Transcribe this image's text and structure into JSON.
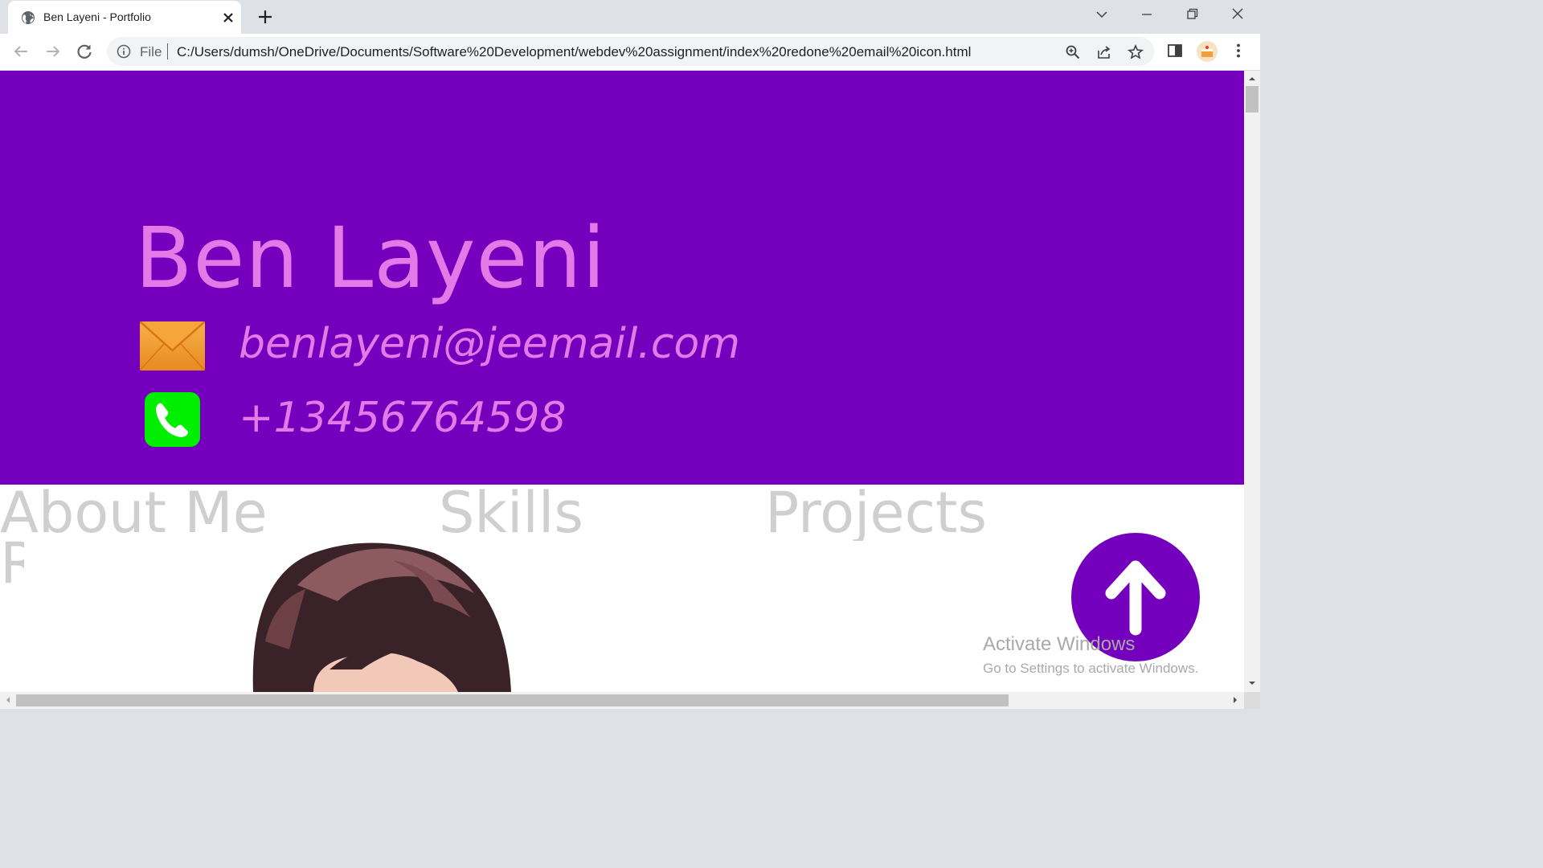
{
  "browser": {
    "tab_title": "Ben Layeni - Portfolio",
    "address_scheme": "File",
    "address_url": "C:/Users/dumsh/OneDrive/Documents/Software%20Development/webdev%20assignment/index%20redone%20email%20icon.html"
  },
  "hero": {
    "name": "Ben Layeni",
    "email": "benlayeni@jeemail.com",
    "phone": "+13456764598"
  },
  "nav": {
    "about": "About Me",
    "skills": "Skills",
    "projects": "Projects",
    "wrapped": "R"
  },
  "watermark": {
    "line1": "Activate Windows",
    "line2": "Go to Settings to activate Windows."
  },
  "colors": {
    "hero_bg": "#7400bd",
    "hero_text": "#e47ae8",
    "nav_text": "#cfcfcf",
    "accent": "#7400bd",
    "phone_icon_bg": "#00ee00",
    "mail_icon": "#f29a2e"
  },
  "icons": {
    "tab": "globe-icon",
    "mail": "envelope-icon",
    "phone": "phone-icon",
    "back_to_top": "arrow-up-icon"
  }
}
